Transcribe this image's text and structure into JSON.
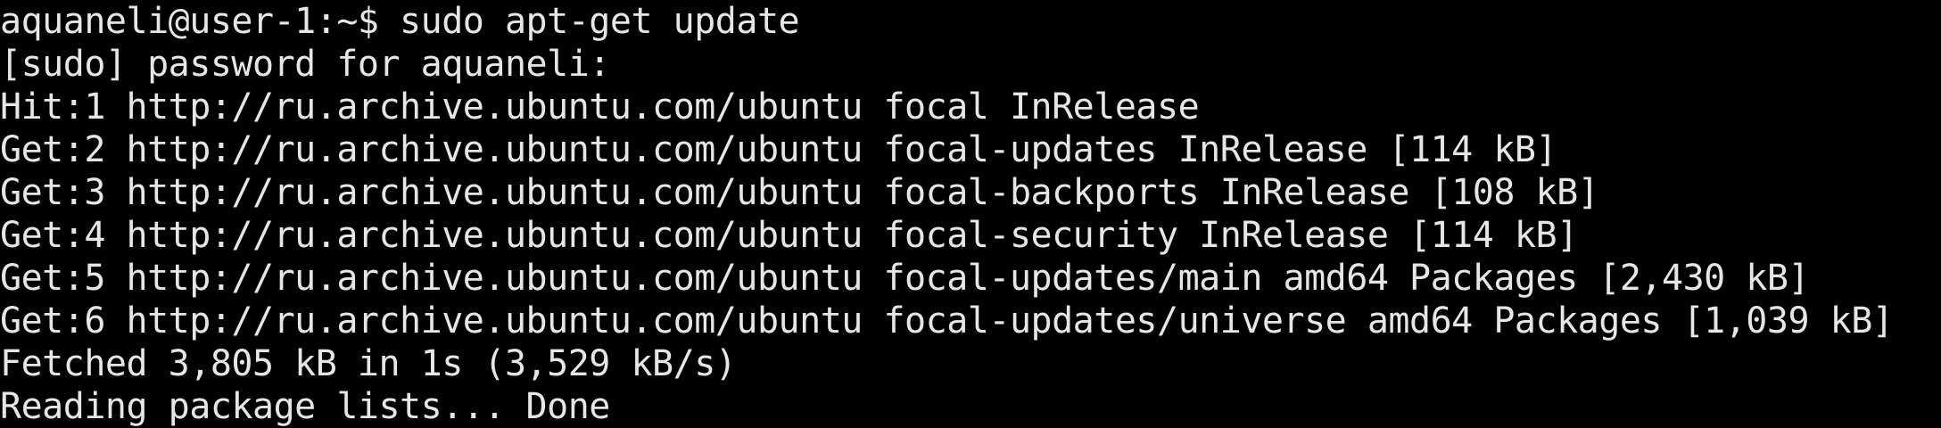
{
  "terminal": {
    "background": "#000000",
    "foreground": "#e6e6e6",
    "lines": [
      "aquaneli@user-1:~$ sudo apt-get update",
      "[sudo] password for aquaneli:",
      "Hit:1 http://ru.archive.ubuntu.com/ubuntu focal InRelease",
      "Get:2 http://ru.archive.ubuntu.com/ubuntu focal-updates InRelease [114 kB]",
      "Get:3 http://ru.archive.ubuntu.com/ubuntu focal-backports InRelease [108 kB]",
      "Get:4 http://ru.archive.ubuntu.com/ubuntu focal-security InRelease [114 kB]",
      "Get:5 http://ru.archive.ubuntu.com/ubuntu focal-updates/main amd64 Packages [2,430 kB]",
      "Get:6 http://ru.archive.ubuntu.com/ubuntu focal-updates/universe amd64 Packages [1,039 kB]",
      "Fetched 3,805 kB in 1s (3,529 kB/s)",
      "Reading package lists... Done"
    ]
  }
}
